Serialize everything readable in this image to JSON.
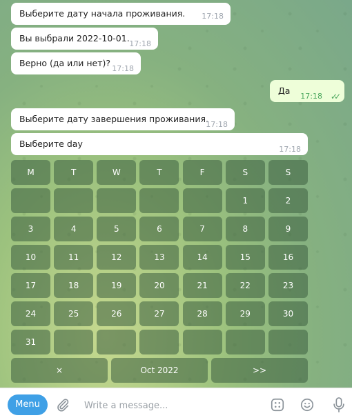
{
  "messages": [
    {
      "text": "Выберите дату начала проживания.",
      "time": "17:18",
      "dir": "in"
    },
    {
      "text": "Вы выбрали 2022-10-01.",
      "time": "17:18",
      "dir": "in"
    },
    {
      "text": "Верно (да или нет)?",
      "time": "17:18",
      "dir": "in"
    },
    {
      "text": "Да",
      "time": "17:18",
      "dir": "out"
    },
    {
      "text": "Выберите дату завершения проживания.",
      "time": "17:18",
      "dir": "in"
    },
    {
      "text": "Выберите day",
      "time": "17:18",
      "dir": "in"
    }
  ],
  "calendar": {
    "weekdays": [
      "M",
      "T",
      "W",
      "T",
      "F",
      "S",
      "S"
    ],
    "weeks": [
      [
        "",
        "",
        "",
        "",
        "",
        "1",
        "2"
      ],
      [
        "3",
        "4",
        "5",
        "6",
        "7",
        "8",
        "9"
      ],
      [
        "10",
        "11",
        "12",
        "13",
        "14",
        "15",
        "16"
      ],
      [
        "17",
        "18",
        "19",
        "20",
        "21",
        "22",
        "23"
      ],
      [
        "24",
        "25",
        "26",
        "27",
        "28",
        "29",
        "30"
      ],
      [
        "31",
        "",
        "",
        "",
        "",
        "",
        ""
      ]
    ],
    "nav": {
      "prev": "×",
      "month": "Oct 2022",
      "next": ">>"
    }
  },
  "composer": {
    "menu_label": "Menu",
    "placeholder": "Write a message...",
    "icons": [
      "paperclip-icon",
      "bot-commands-icon",
      "emoji-icon",
      "microphone-icon"
    ]
  }
}
